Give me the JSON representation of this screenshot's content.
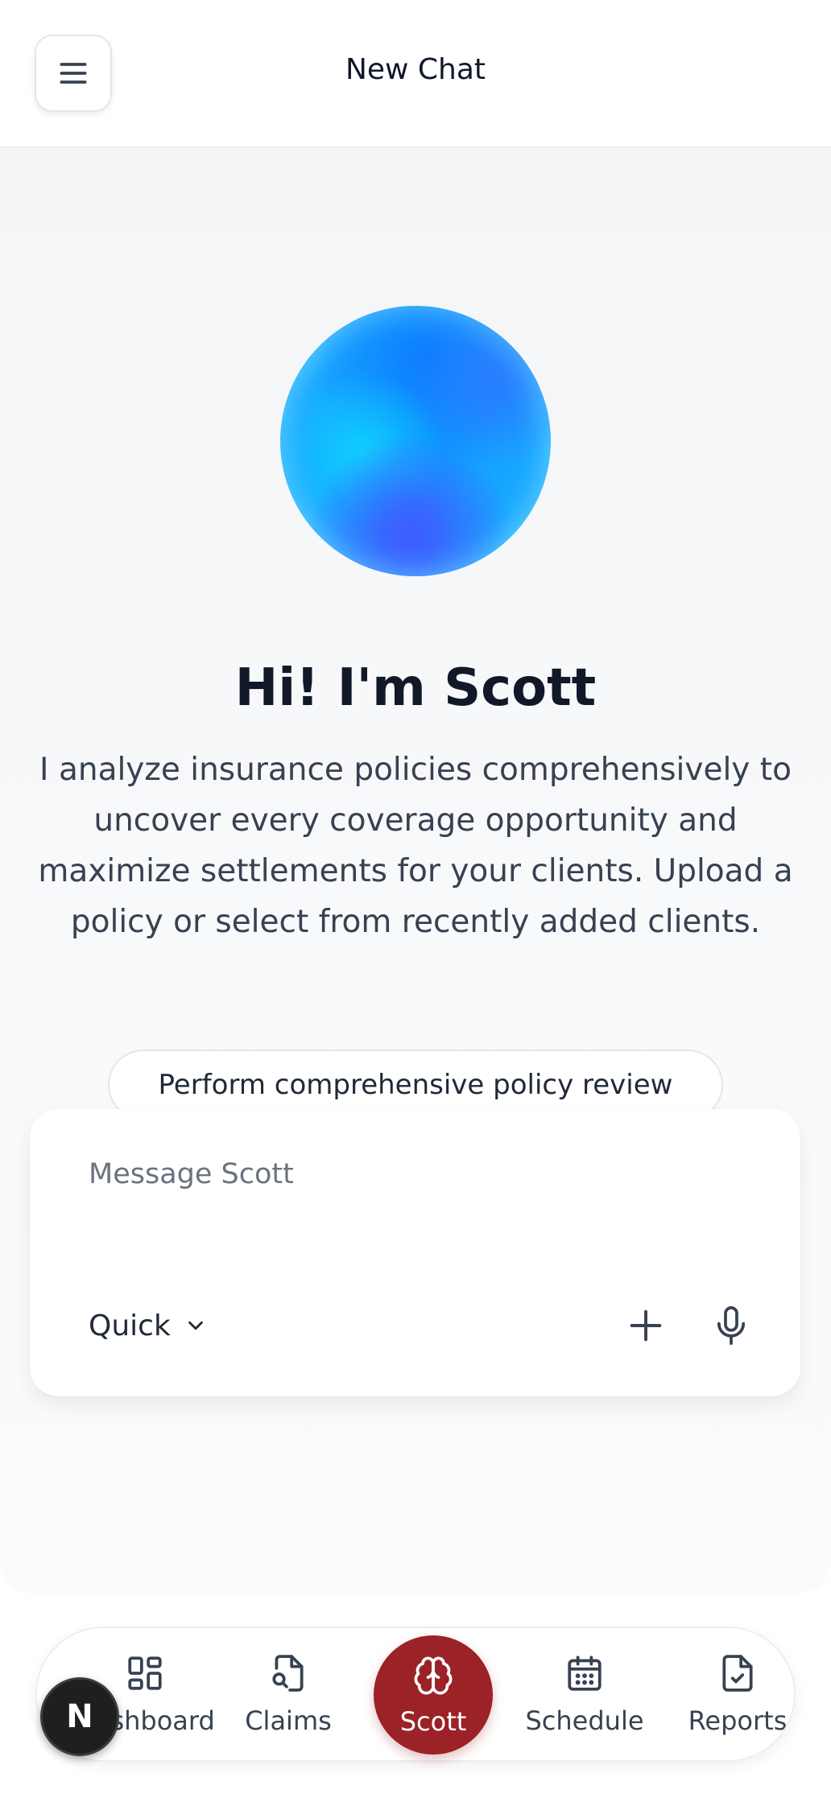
{
  "header": {
    "title": "New Chat",
    "menu_icon": "hamburger-menu-icon"
  },
  "hero": {
    "avatar": "scott-orb",
    "greeting": "Hi! I'm Scott",
    "intro": "I analyze insurance policies comprehensively to uncover every coverage opportunity and maximize settlements for your clients. Upload a policy or select from recently added clients."
  },
  "suggestions": [
    {
      "label": "Perform comprehensive policy review"
    }
  ],
  "composer": {
    "placeholder": "Message Scott",
    "value": "",
    "mode": "Quick",
    "mode_icon": "chevron-down-icon",
    "add_icon": "plus-icon",
    "mic_icon": "microphone-icon"
  },
  "bottom_nav": {
    "items": [
      {
        "label": "Dashboard",
        "icon": "dashboard-grid-icon",
        "active": false
      },
      {
        "label": "Claims",
        "icon": "file-search-icon",
        "active": false
      },
      {
        "label": "Scott",
        "icon": "brain-icon",
        "active": true
      },
      {
        "label": "Schedule",
        "icon": "calendar-icon",
        "active": false
      },
      {
        "label": "Reports",
        "icon": "file-check-icon",
        "active": false
      }
    ],
    "active_color": "#9b2226"
  },
  "dev_badge": {
    "letter": "N"
  },
  "colors": {
    "text_primary": "#111827",
    "text_secondary": "#374151",
    "placeholder": "#6b7280",
    "accent": "#9b2226",
    "orb_blue": "#0a9dff"
  }
}
